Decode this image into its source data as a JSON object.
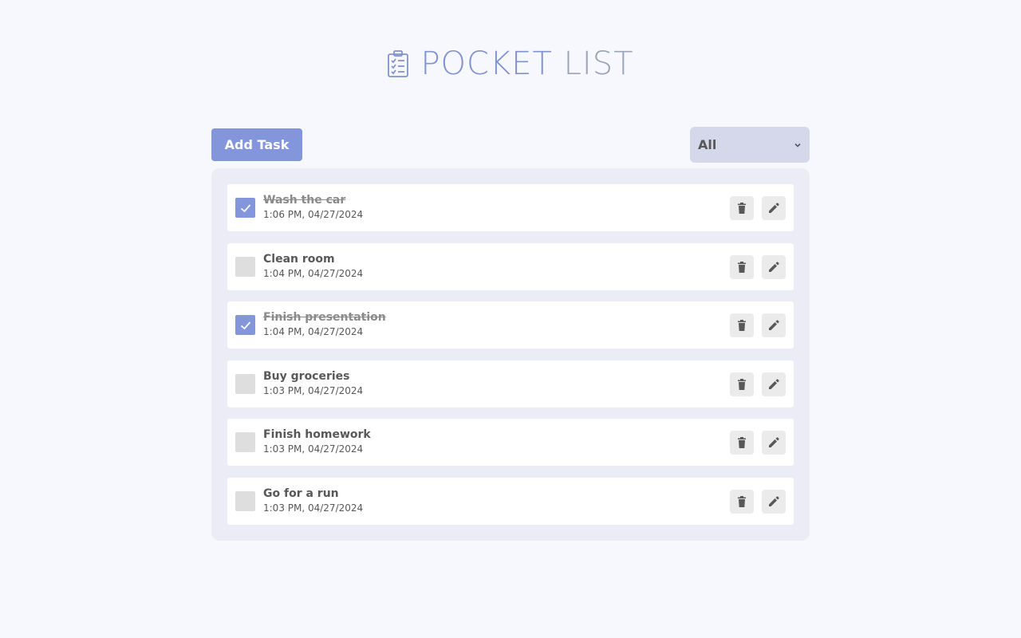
{
  "app": {
    "title_part1": "POCKET",
    "title_part2": "LIST",
    "icon": "clipboard-checklist-icon",
    "colors": {
      "accent": "#8396dc",
      "title_primary": "#7f92d1",
      "title_secondary": "#9aa3b8",
      "page_bg": "#f7f8fd",
      "panel_bg": "#ebecf6",
      "select_bg": "#d4d8ea",
      "checkbox_unchecked": "#dedede"
    }
  },
  "toolbar": {
    "add_task_label": "Add Task",
    "filter_selected": "All"
  },
  "tasks": [
    {
      "title": "Wash the car",
      "time": "1:06 PM, 04/27/2024",
      "completed": true
    },
    {
      "title": "Clean room",
      "time": "1:04 PM, 04/27/2024",
      "completed": false
    },
    {
      "title": "Finish presentation",
      "time": "1:04 PM, 04/27/2024",
      "completed": true
    },
    {
      "title": "Buy groceries",
      "time": "1:03 PM, 04/27/2024",
      "completed": false
    },
    {
      "title": "Finish homework",
      "time": "1:03 PM, 04/27/2024",
      "completed": false
    },
    {
      "title": "Go for a run",
      "time": "1:03 PM, 04/27/2024",
      "completed": false
    }
  ],
  "icons": {
    "delete": "trash-icon",
    "edit": "pencil-icon",
    "check": "check-icon",
    "filter_chevron": "chevron-down-icon"
  }
}
